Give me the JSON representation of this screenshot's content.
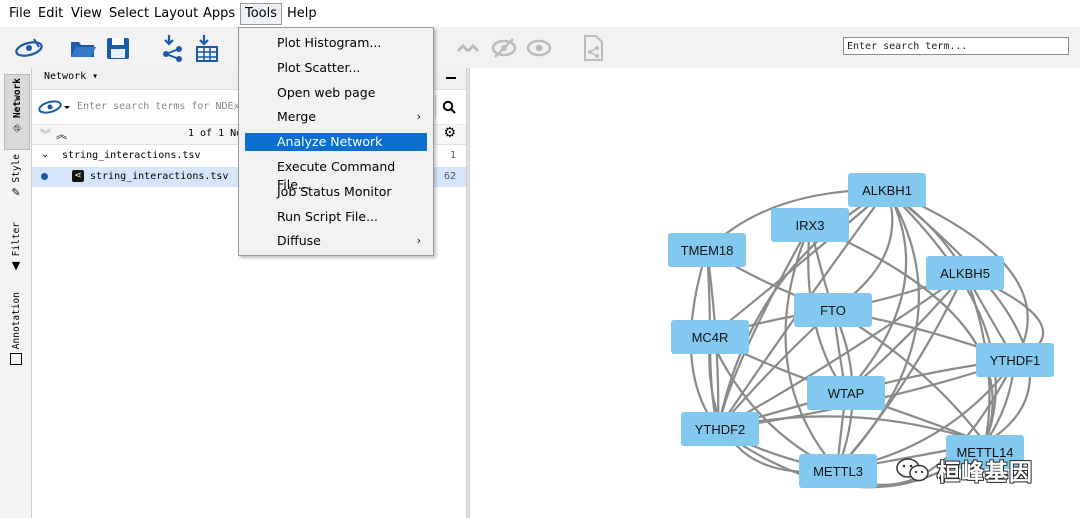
{
  "menubar": {
    "items": [
      "File",
      "Edit",
      "View",
      "Select",
      "Layout",
      "Apps",
      "Tools",
      "Help"
    ]
  },
  "toolbar": {
    "icons": [
      "cytoscape-logo-icon",
      "open-folder-icon",
      "save-icon",
      "import-network-icon",
      "import-table-icon",
      "hide-icon",
      "show-icon",
      "eye-icon",
      "new-network-icon"
    ],
    "search_placeholder": "Enter search term..."
  },
  "side_tabs": [
    "Network",
    "Style",
    "Filter",
    "Annotation"
  ],
  "network_panel": {
    "title": "Network ▾",
    "ndex_placeholder": "Enter search terms for NDEx...",
    "count_label": "1 of 1 Ne",
    "collection": {
      "name": "string_interactions.tsv",
      "count": "1"
    },
    "network": {
      "name": "string_interactions.tsv",
      "count": "62"
    }
  },
  "tools_menu": {
    "items": [
      {
        "label": "Plot Histogram...",
        "submenu": false,
        "highlighted": false
      },
      {
        "label": "Plot Scatter...",
        "submenu": false,
        "highlighted": false
      },
      {
        "label": "Open web page",
        "submenu": false,
        "highlighted": false
      },
      {
        "label": "Merge",
        "submenu": true,
        "highlighted": false
      },
      {
        "label": "Analyze Network",
        "submenu": false,
        "highlighted": true
      },
      {
        "label": "Execute Command File...",
        "submenu": false,
        "highlighted": false
      },
      {
        "label": "Job Status Monitor",
        "submenu": false,
        "highlighted": false
      },
      {
        "label": "Run Script File...",
        "submenu": false,
        "highlighted": false
      },
      {
        "label": "Diffuse",
        "submenu": true,
        "highlighted": false
      }
    ]
  },
  "graph": {
    "node_color": "#82c8ef",
    "edge_color": "#8a8a8a",
    "nodes": [
      "ALKBH1",
      "IRX3",
      "TMEM18",
      "ALKBH5",
      "FTO",
      "MC4R",
      "YTHDF1",
      "WTAP",
      "YTHDF2",
      "METTL14",
      "METTL3"
    ]
  },
  "colors": {
    "highlight": "#0a6fd1",
    "selected_row": "#d5e6fb",
    "toolbar_blue": "#1a5aa6"
  },
  "watermark": {
    "text": "桓峰基因"
  }
}
